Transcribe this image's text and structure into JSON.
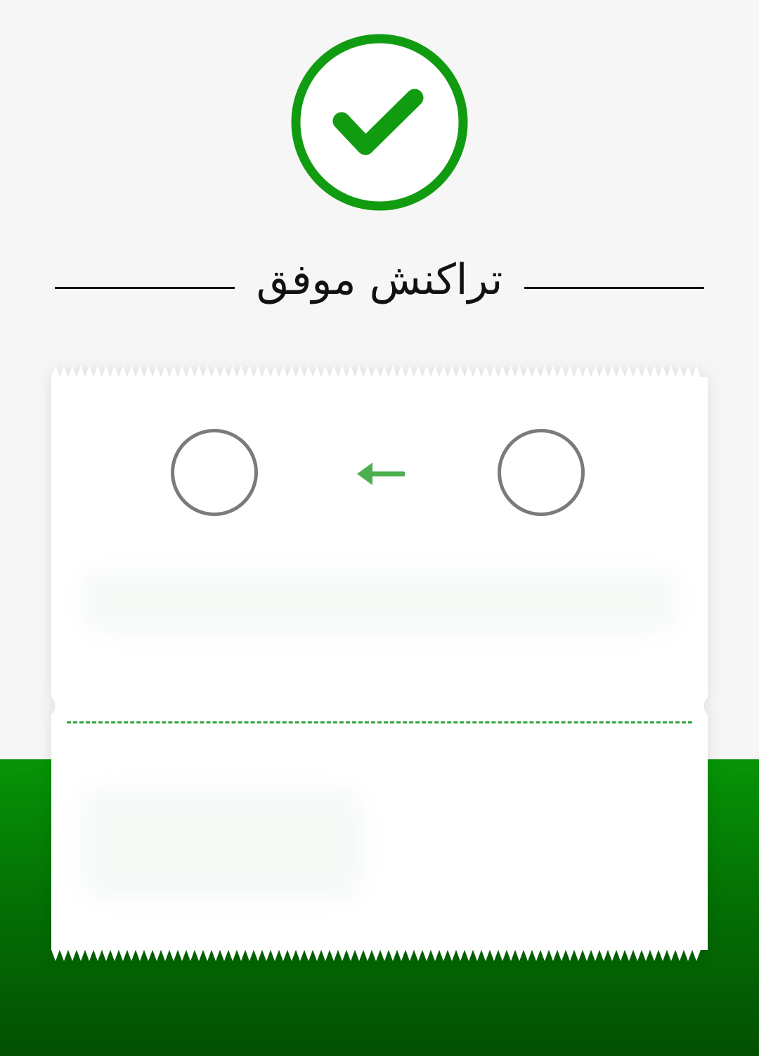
{
  "header": {
    "status_icon": "check-circle-icon",
    "title": "تراکنش موفق"
  },
  "receipt": {
    "source_icon": "empty-account-circle-icon",
    "destination_icon": "empty-account-circle-icon",
    "transfer_icon": "arrow-left-icon"
  },
  "colors": {
    "success_green": "#119b11",
    "arrow_green": "#4caf50",
    "divider_green": "#2fa53b",
    "band_top": "#079407",
    "band_bottom": "#035003",
    "circle_gray": "#7b7b7b"
  }
}
